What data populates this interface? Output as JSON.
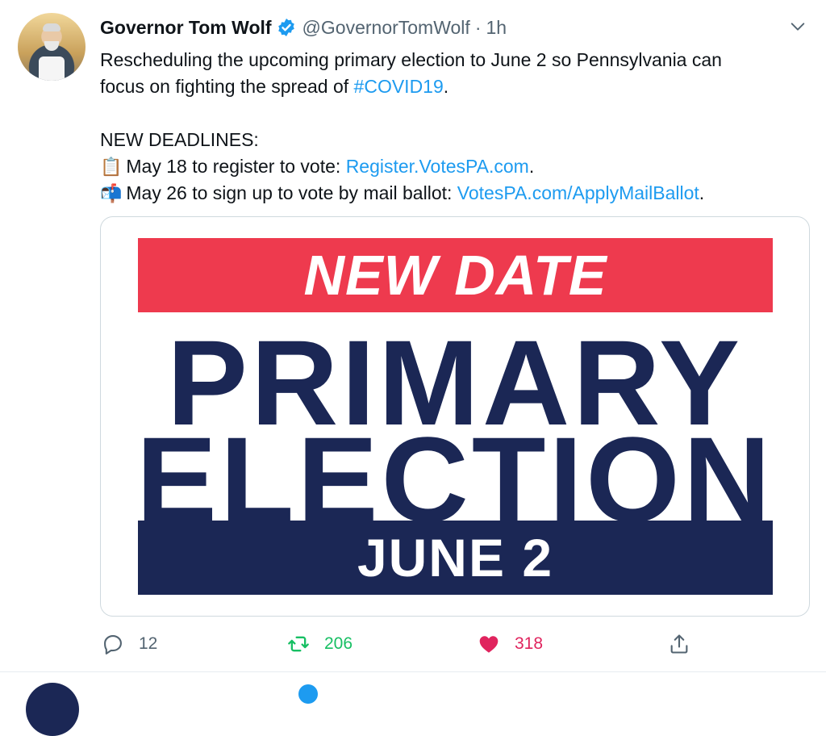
{
  "author": {
    "name": "Governor Tom Wolf",
    "handle": "@GovernorTomWolf",
    "separator": "·",
    "time": "1h"
  },
  "tweet": {
    "line1": "Rescheduling the upcoming primary election to June 2 so Pennsylvania can",
    "line2_prefix": "focus on fighting the spread of ",
    "hashtag": "#COVID19",
    "line2_suffix": ".",
    "deadlines_heading": "NEW DEADLINES:",
    "deadline1_emoji": "📋",
    "deadline1_text": "May 18 to register to vote: ",
    "deadline1_link": "Register.VotesPA.com",
    "deadline1_suffix": ".",
    "deadline2_emoji": "📬",
    "deadline2_text": "May 26 to sign up to vote by mail ballot: ",
    "deadline2_link": "VotesPA.com/ApplyMailBallot",
    "deadline2_suffix": "."
  },
  "image": {
    "top_banner": "NEW DATE",
    "line1": "PRIMARY",
    "line2": "ELECTION",
    "bottom_banner": "JUNE 2"
  },
  "actions": {
    "replies": "12",
    "retweets": "206",
    "likes": "318"
  },
  "colors": {
    "link": "#1d9bf0",
    "retweet": "#17bf63",
    "like": "#e0245e",
    "banner_red": "#ee3a4e",
    "navy": "#1b2755"
  },
  "icons": [
    "verified-badge-icon",
    "chevron-down-icon",
    "reply-icon",
    "retweet-icon",
    "heart-icon",
    "share-icon"
  ]
}
